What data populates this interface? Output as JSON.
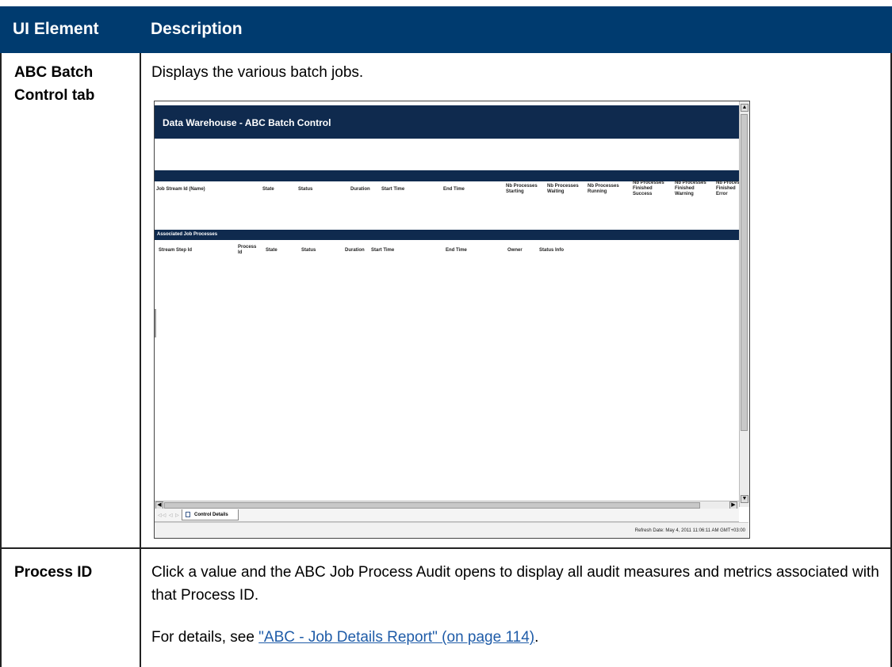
{
  "header": {
    "col1": "UI Element",
    "col2": "Description"
  },
  "rows": [
    {
      "element": "ABC Batch Control tab",
      "description": "Displays the various batch jobs."
    },
    {
      "element": "Process ID",
      "description": "Click a value and the ABC Job Process Audit opens to display all audit measures and metrics associated with that Process ID.",
      "details_prefix": "For details, see ",
      "details_link": "\"ABC - Job Details Report\" (on page 114)",
      "details_suffix": "."
    }
  ],
  "screenshot": {
    "title": "Data Warehouse - ABC Batch Control",
    "job_columns": [
      "Job Stream Id (Name)",
      "State",
      "Status",
      "Duration",
      "Start Time",
      "End Time",
      "Nb Processes Starting",
      "Nb Processes Waiting",
      "Nb Processes Running",
      "Nb Processes Finished Success",
      "Nb Processes Finished Warning",
      "Nb Processes Finished Error"
    ],
    "section_title": "Associated Job Processes",
    "process_columns": [
      "Stream Step Id",
      "Process Id",
      "State",
      "Status",
      "Duration",
      "Start Time",
      "End Time",
      "Owner",
      "Status Info"
    ],
    "tab_label": "Control Details",
    "nav_glyphs": "◁◁ ◁ ▷ ▷▷",
    "status_text": "Refresh Date: May 4, 2011 11:06:11 AM GMT+03:00"
  }
}
